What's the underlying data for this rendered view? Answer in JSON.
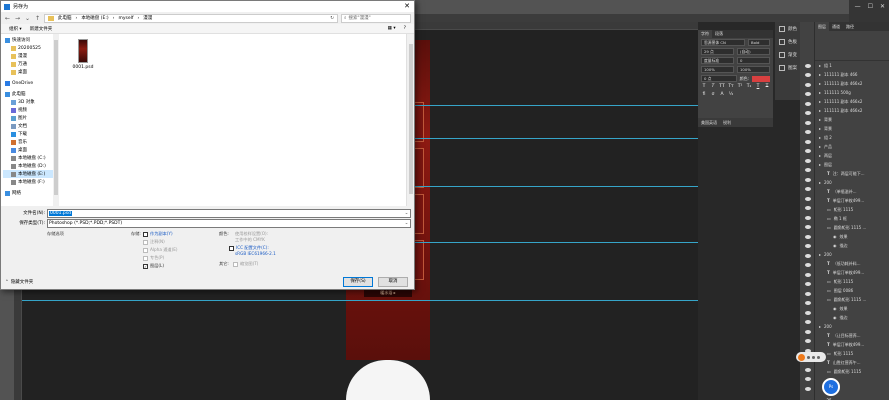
{
  "dialog": {
    "title": "另存为",
    "close": "✕",
    "address": [
      "此电脑",
      "本地磁盘 (E:)",
      "myself",
      "漫漫"
    ],
    "search_placeholder": "搜索\"漫漫\"",
    "toolbar": {
      "organize": "组织 ▾",
      "new_folder": "新建文件夹",
      "view": "▦ ▾",
      "help": "?"
    },
    "tree": [
      {
        "label": "快速访问",
        "icon": "star-icon"
      },
      {
        "label": "20200525",
        "icon": "folder-icon"
      },
      {
        "label": "漫漫",
        "icon": "folder-icon"
      },
      {
        "label": "万通",
        "icon": "folder-icon"
      },
      {
        "label": "桌面",
        "icon": "folder-icon"
      },
      {
        "label": "OneDrive",
        "icon": "cloud-icon"
      },
      {
        "label": "此电脑",
        "icon": "computer-icon"
      },
      {
        "label": "3D 对象",
        "icon": "cube-icon"
      },
      {
        "label": "视频",
        "icon": "video-icon"
      },
      {
        "label": "图片",
        "icon": "image-icon"
      },
      {
        "label": "文档",
        "icon": "document-icon"
      },
      {
        "label": "下载",
        "icon": "download-icon"
      },
      {
        "label": "音乐",
        "icon": "music-icon"
      },
      {
        "label": "桌面",
        "icon": "desktop-icon"
      },
      {
        "label": "本地磁盘 (C:)",
        "icon": "drive-icon"
      },
      {
        "label": "本地磁盘 (D:)",
        "icon": "drive-icon"
      },
      {
        "label": "本地磁盘 (E:)",
        "icon": "drive-icon"
      },
      {
        "label": "本地磁盘 (F:)",
        "icon": "drive-icon"
      },
      {
        "label": "网络",
        "icon": "network-icon"
      }
    ],
    "file": {
      "name": "0001.psd"
    },
    "filename_label": "文件名(N):",
    "filename_value": "0001.psd",
    "savetype_label": "保存类型(T):",
    "savetype_value": "Photoshop (*.PSD;*.PDD;*.PSDT)",
    "options": {
      "section": "存储选项",
      "storage": "存储:",
      "as_copy": "作为副本(Y)",
      "notes": "注释(N)",
      "alpha": "Alpha 通道(E)",
      "spot": "专色(P)",
      "layers": "图层(L)",
      "color": "颜色:",
      "use_proof": "使用校样设置(O):",
      "proof_value": "工作中的 CMYK",
      "icc": "ICC 配置文件(C):",
      "icc_value": "sRGB IEC61966-2.1",
      "other": "其它:",
      "thumbnail": "缩览图(T)"
    },
    "hide_folders": "隐藏文件夹",
    "save_button": "保存(S)",
    "cancel_button": "取消"
  },
  "photoshop": {
    "canvas_badge": "暖水浴 ▸",
    "dock": [
      "颜色",
      "色板",
      "渐变",
      "图案"
    ],
    "char_tabs": [
      "字符",
      "段落"
    ],
    "char": {
      "font": "思源黑体 CN",
      "style": "Bold",
      "size": "29 点",
      "leading": "(自动)",
      "tracking": "0",
      "kern": "度量标准",
      "vscale": "100%",
      "hscale": "100%",
      "baseline": "0 点",
      "color_label": "颜色:",
      "lang": "美国英语",
      "aa": "锐利",
      "color": "#d84040"
    },
    "layer_tabs": [
      "图层",
      "通道",
      "路径"
    ],
    "layers": [
      {
        "name": "组 1",
        "kind": "group"
      },
      {
        "name": "111111 副本 466",
        "kind": "group"
      },
      {
        "name": "111111 副本 466x2",
        "kind": "group"
      },
      {
        "name": "111111 500g",
        "kind": "group"
      },
      {
        "name": "111111 副本 466x2",
        "kind": "group"
      },
      {
        "name": "111111 副本 466x2",
        "kind": "group"
      },
      {
        "name": "背景",
        "kind": "group"
      },
      {
        "name": "背景",
        "kind": "group"
      },
      {
        "name": "组 2",
        "kind": "group"
      },
      {
        "name": "产品",
        "kind": "group"
      },
      {
        "name": "两层",
        "kind": "group"
      },
      {
        "name": "图层",
        "kind": "group"
      },
      {
        "name": "注：两层可能下...",
        "kind": "text"
      },
      {
        "name": "200",
        "kind": "group"
      },
      {
        "name": "（单瓶滋补...",
        "kind": "text"
      },
      {
        "name": "单层汀单枚499...",
        "kind": "text"
      },
      {
        "name": "矩形 1115",
        "kind": "shape"
      },
      {
        "name": "椭 1 框",
        "kind": "shape"
      },
      {
        "name": "圆角矩形 1115 ...",
        "kind": "shape"
      },
      {
        "name": "效果",
        "kind": "fx"
      },
      {
        "name": "描边",
        "kind": "fx"
      },
      {
        "name": "200",
        "kind": "group"
      },
      {
        "name": "（低功耗补料...",
        "kind": "text"
      },
      {
        "name": "单层汀单枚499...",
        "kind": "text"
      },
      {
        "name": "矩形 1115",
        "kind": "shape"
      },
      {
        "name": "图层 0086",
        "kind": "shape"
      },
      {
        "name": "圆角矩形 1115 ...",
        "kind": "shape"
      },
      {
        "name": "效果",
        "kind": "fx"
      },
      {
        "name": "描边",
        "kind": "fx"
      },
      {
        "name": "200",
        "kind": "group"
      },
      {
        "name": "（让目标营养...",
        "kind": "text"
      },
      {
        "name": "单层汀单枚499...",
        "kind": "text"
      },
      {
        "name": "矩形 1115",
        "kind": "shape"
      },
      {
        "name": "山胜红营养午...",
        "kind": "text"
      },
      {
        "name": "圆角矩形 1115",
        "kind": "shape"
      }
    ],
    "blue_badge": "Ps 25..."
  }
}
